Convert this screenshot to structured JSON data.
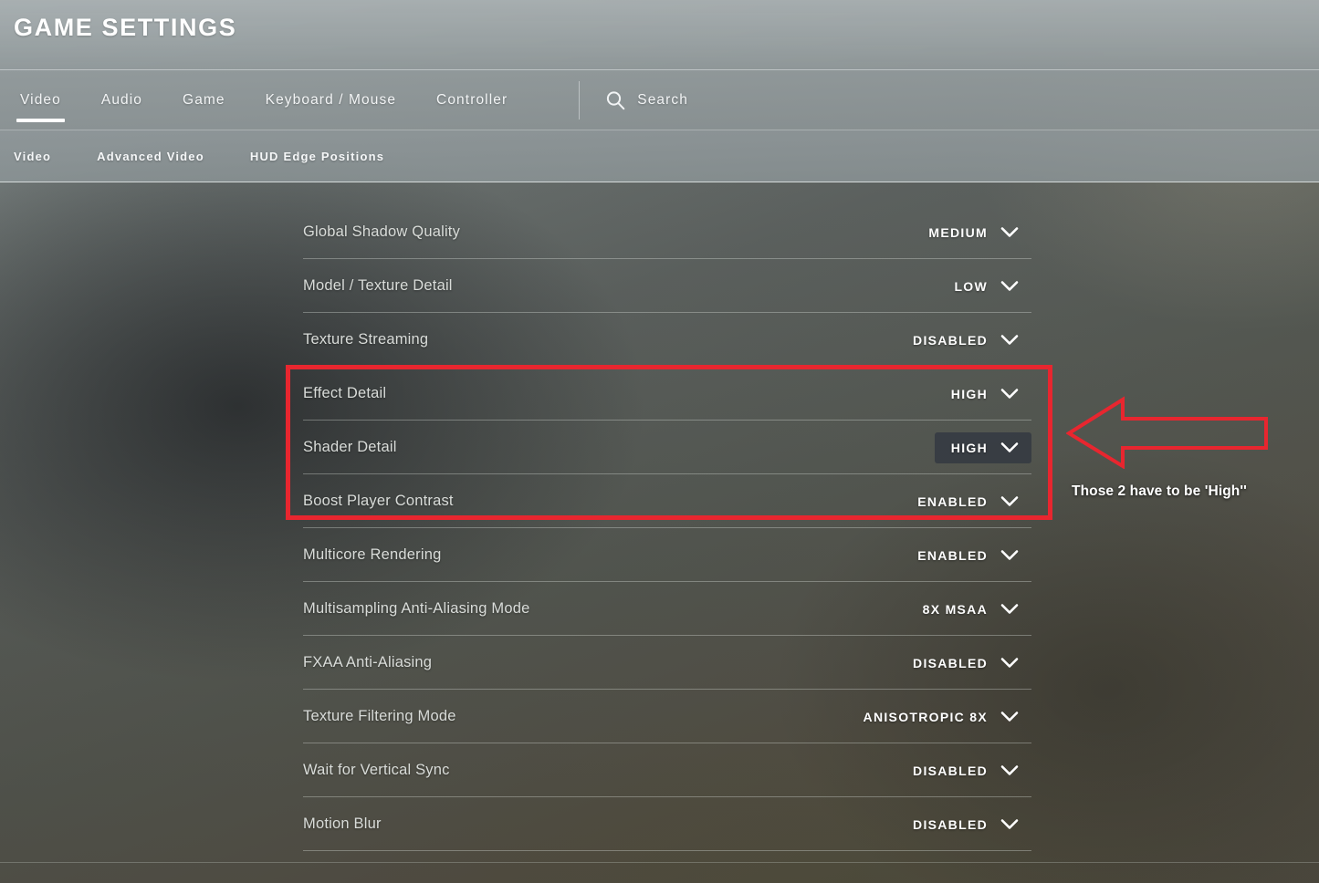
{
  "header": {
    "title": "GAME SETTINGS"
  },
  "tabs": [
    {
      "label": "Video",
      "active": true
    },
    {
      "label": "Audio",
      "active": false
    },
    {
      "label": "Game",
      "active": false
    },
    {
      "label": "Keyboard / Mouse",
      "active": false
    },
    {
      "label": "Controller",
      "active": false
    }
  ],
  "search": {
    "icon": "search-icon",
    "label": "Search"
  },
  "subtabs": [
    {
      "label": "Video",
      "active": true
    },
    {
      "label": "Advanced Video",
      "active": false
    },
    {
      "label": "HUD Edge Positions",
      "active": false
    }
  ],
  "settings": [
    {
      "label": "Global Shadow Quality",
      "value": "MEDIUM",
      "hovered": false
    },
    {
      "label": "Model / Texture Detail",
      "value": "LOW",
      "hovered": false
    },
    {
      "label": "Texture Streaming",
      "value": "DISABLED",
      "hovered": false
    },
    {
      "label": "Effect Detail",
      "value": "HIGH",
      "hovered": false
    },
    {
      "label": "Shader Detail",
      "value": "HIGH",
      "hovered": true
    },
    {
      "label": "Boost Player Contrast",
      "value": "ENABLED",
      "hovered": false
    },
    {
      "label": "Multicore Rendering",
      "value": "ENABLED",
      "hovered": false
    },
    {
      "label": "Multisampling Anti-Aliasing Mode",
      "value": "8X MSAA",
      "hovered": false
    },
    {
      "label": "FXAA Anti-Aliasing",
      "value": "DISABLED",
      "hovered": false
    },
    {
      "label": "Texture Filtering Mode",
      "value": "ANISOTROPIC 8X",
      "hovered": false
    },
    {
      "label": "Wait for Vertical Sync",
      "value": "DISABLED",
      "hovered": false
    },
    {
      "label": "Motion Blur",
      "value": "DISABLED",
      "hovered": false
    }
  ],
  "annotation": {
    "text": "Those 2 have to be 'High''",
    "color": "#e8262f",
    "arrow_icon": "left-arrow-icon",
    "highlight_icon": "rectangle-highlight"
  },
  "colors": {
    "accent_red": "#e8262f",
    "header_bg": "#9aa2a4",
    "value_text": "#ffffff",
    "label_text": "#d9dcd9",
    "hover_bg": "#343a42"
  }
}
